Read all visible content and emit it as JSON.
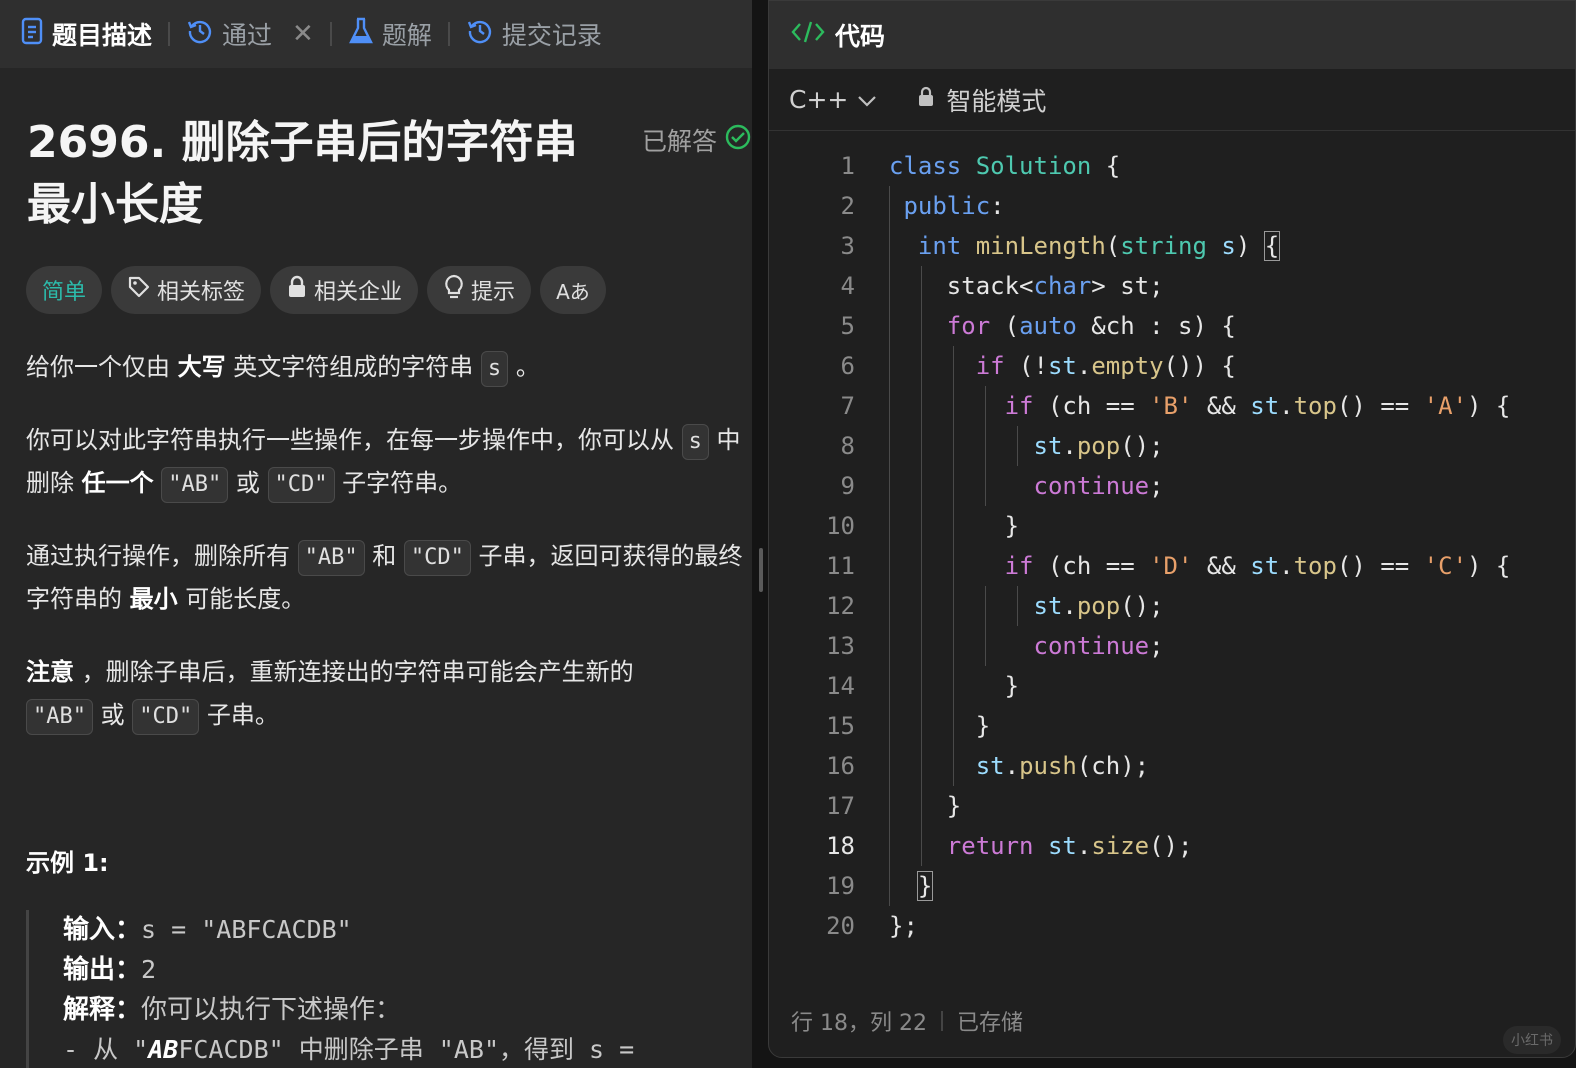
{
  "left_tabs": [
    {
      "label": "题目描述",
      "icon": "document-icon",
      "active": true
    },
    {
      "label": "通过",
      "icon": "history-icon",
      "close": "✕"
    },
    {
      "label": "题解",
      "icon": "flask-icon"
    },
    {
      "label": "提交记录",
      "icon": "history-icon"
    }
  ],
  "problem": {
    "title": "2696. 删除子串后的字符串最小长度",
    "solved_label": "已解答",
    "chips": {
      "difficulty": "简单",
      "tags": "相关标签",
      "companies": "相关企业",
      "hint": "提示",
      "font_size": "Aあ"
    },
    "desc": {
      "p1_a": "给你一个仅由",
      "p1_b": "大写",
      "p1_c": "英文字符组成的字符串",
      "p1_code": "s",
      "p1_d": "。",
      "p2_a": "你可以对此字符串执行一些操作，在每一步操作中，你可以从",
      "p2_code1": "s",
      "p2_b": "中删除",
      "p2_c": "任一个",
      "p2_code2": "\"AB\"",
      "p2_d": "或",
      "p2_code3": "\"CD\"",
      "p2_e": "子字符串。",
      "p3_a": "通过执行操作，删除所有",
      "p3_code1": "\"AB\"",
      "p3_b": "和",
      "p3_code2": "\"CD\"",
      "p3_c": "子串，返回可获得的最终字符串的",
      "p3_d": "最小",
      "p3_e": "可能长度。",
      "p4_a": "注意",
      "p4_b": "，删除子串后，重新连接出的字符串可能会产生新的",
      "p4_code1": "\"AB\"",
      "p4_c": "或",
      "p4_code2": "\"CD\"",
      "p4_d": "子串。"
    },
    "example": {
      "title": "示例 1:",
      "input_label": "输入：",
      "input_value": "s = \"ABFCACDB\"",
      "output_label": "输出：",
      "output_value": "2",
      "explain_label": "解释：",
      "explain_value": "你可以执行下述操作：",
      "step1_a": "- 从 \"",
      "step1_b": "AB",
      "step1_c": "FCACDB\" 中删除子串 \"AB\"，得到 s ="
    }
  },
  "editor": {
    "tab_label": "代码",
    "language": "C++",
    "mode": "智能模式",
    "line_numbers": [
      "1",
      "2",
      "3",
      "4",
      "5",
      "6",
      "7",
      "8",
      "9",
      "10",
      "11",
      "12",
      "13",
      "14",
      "15",
      "16",
      "17",
      "18",
      "19",
      "20"
    ],
    "current_line": 18,
    "status_position": "行 18，列 22",
    "status_saved": "已存储"
  },
  "watermark": "小红书"
}
